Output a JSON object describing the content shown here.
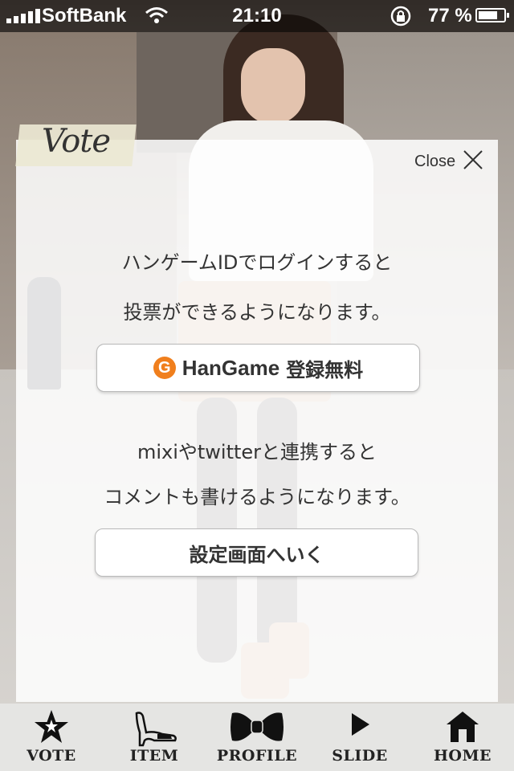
{
  "status_bar": {
    "carrier": "SoftBank",
    "time": "21:10",
    "battery_percent": "77 %",
    "battery_level": 0.77
  },
  "vote_panel": {
    "title": "Vote",
    "close_label": "Close",
    "login_message_line1": "ハンゲームIDでログインすると",
    "login_message_line2": "投票ができるようになります。",
    "hangame_button": {
      "logo_letter": "G",
      "brand": "HanGame",
      "label": "登録無料"
    },
    "social_message_line1": "mixiやtwitterと連携すると",
    "social_message_line2": "コメントも書けるようになります。",
    "settings_button_label": "設定画面へいく"
  },
  "tab_bar": {
    "items": [
      {
        "label": "VOTE",
        "icon": "star-icon"
      },
      {
        "label": "ITEM",
        "icon": "high-heel-icon"
      },
      {
        "label": "PROFILE",
        "icon": "bow-icon"
      },
      {
        "label": "SLIDE",
        "icon": "play-icon"
      },
      {
        "label": "HOME",
        "icon": "house-icon"
      }
    ]
  }
}
